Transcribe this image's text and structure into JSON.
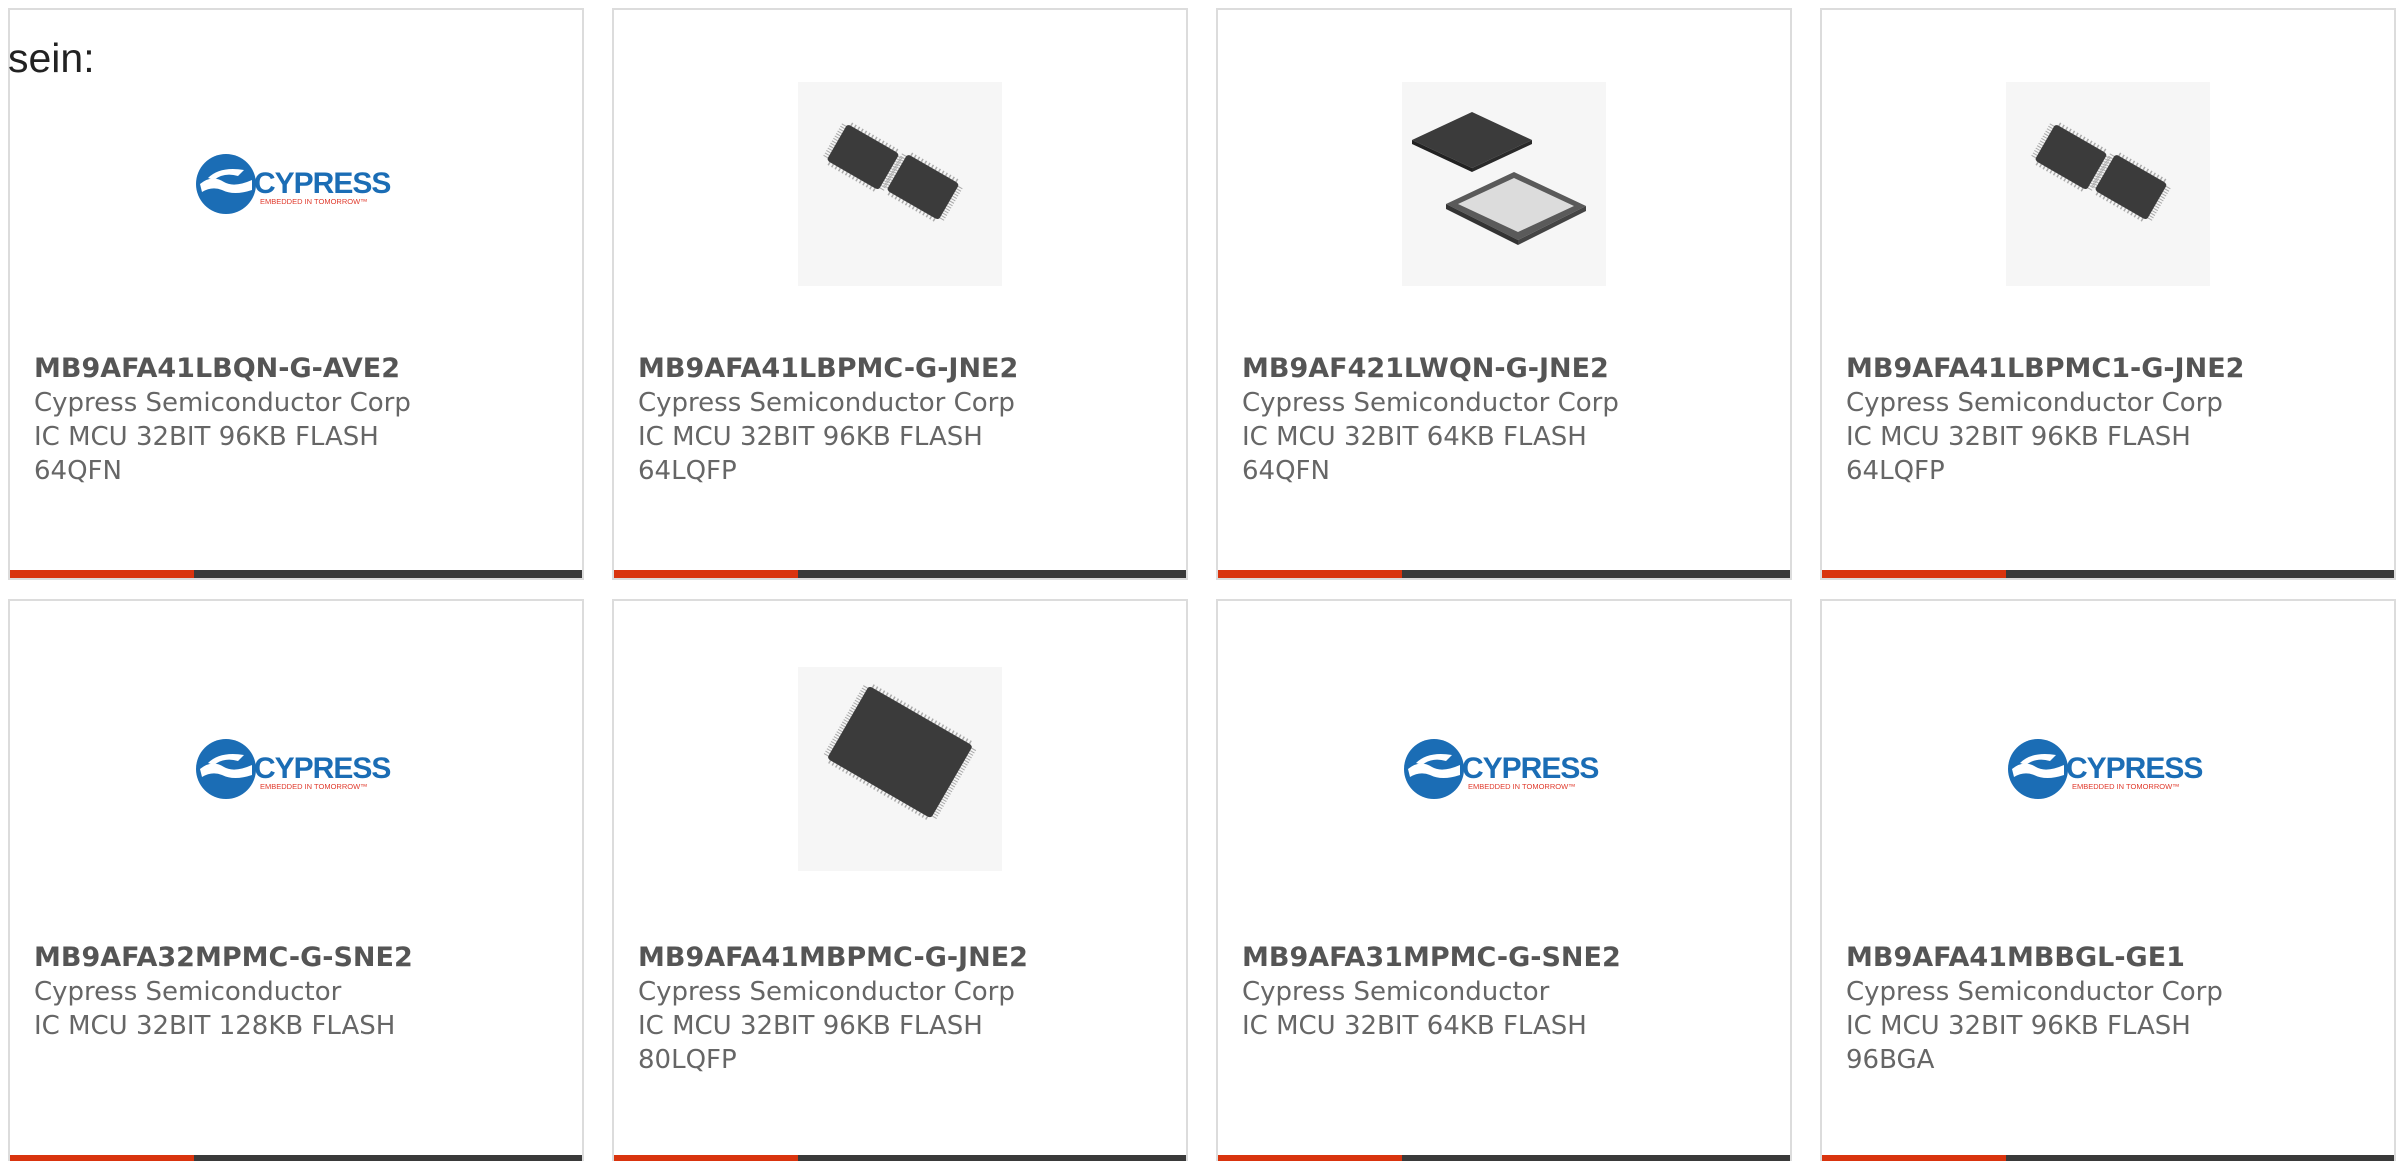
{
  "heading": "sein:",
  "colors": {
    "accent": "#d9340e",
    "bar": "#3a3a3a",
    "logo_blue": "#1b6db5",
    "logo_red": "#e03a2c"
  },
  "products": [
    {
      "part": "MB9AFA41LBQN-G-AVE2",
      "manufacturer": "Cypress Semiconductor Corp",
      "desc1": "IC MCU 32BIT 96KB FLASH",
      "desc2": "64QFN",
      "image": "cypress-logo"
    },
    {
      "part": "MB9AFA41LBPMC-G-JNE2",
      "manufacturer": "Cypress Semiconductor Corp",
      "desc1": "IC MCU 32BIT 96KB FLASH",
      "desc2": "64LQFP",
      "image": "lqfp-pair"
    },
    {
      "part": "MB9AF421LWQN-G-JNE2",
      "manufacturer": "Cypress Semiconductor Corp",
      "desc1": "IC MCU 32BIT 64KB FLASH",
      "desc2": "64QFN",
      "image": "qfn-pair"
    },
    {
      "part": "MB9AFA41LBPMC1-G-JNE2",
      "manufacturer": "Cypress Semiconductor Corp",
      "desc1": "IC MCU 32BIT 96KB FLASH",
      "desc2": "64LQFP",
      "image": "lqfp-pair"
    },
    {
      "part": "MB9AFA32MPMC-G-SNE2",
      "manufacturer": "Cypress Semiconductor",
      "desc1": "IC MCU 32BIT 128KB FLASH",
      "desc2": "",
      "image": "cypress-logo"
    },
    {
      "part": "MB9AFA41MBPMC-G-JNE2",
      "manufacturer": "Cypress Semiconductor Corp",
      "desc1": "IC MCU 32BIT 96KB FLASH",
      "desc2": "80LQFP",
      "image": "lqfp-single"
    },
    {
      "part": "MB9AFA31MPMC-G-SNE2",
      "manufacturer": "Cypress Semiconductor",
      "desc1": "IC MCU 32BIT 64KB FLASH",
      "desc2": "",
      "image": "cypress-logo"
    },
    {
      "part": "MB9AFA41MBBGL-GE1",
      "manufacturer": "Cypress Semiconductor Corp",
      "desc1": "IC MCU 32BIT 96KB FLASH",
      "desc2": "96BGA",
      "image": "cypress-logo"
    }
  ],
  "logo": {
    "wordmark": "CYPRESS",
    "tagline": "EMBEDDED IN TOMORROW™"
  }
}
